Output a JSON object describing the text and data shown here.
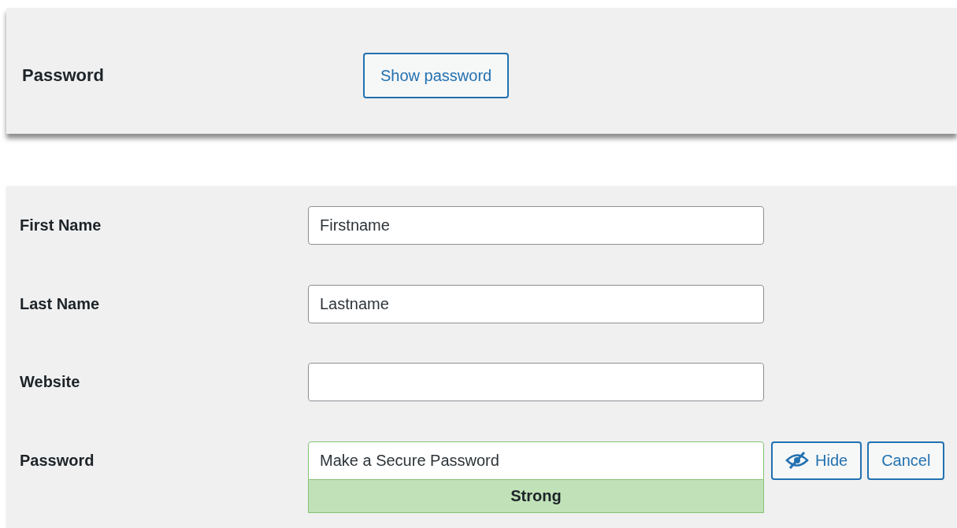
{
  "top_panel": {
    "label": "Password",
    "button": "Show password"
  },
  "form": {
    "rows": [
      {
        "kind": "text",
        "label": "First Name",
        "value": "Firstname"
      },
      {
        "kind": "text",
        "label": "Last Name",
        "value": "Lastname"
      },
      {
        "kind": "text",
        "label": "Website"
      },
      {
        "kind": "password",
        "label": "Password",
        "value": "Make a Secure Password",
        "strength": {
          "kind": "strong",
          "label": "Strong"
        },
        "buttons": [
          {
            "kind": "hide",
            "label": "Hide"
          },
          {
            "kind": "cancel",
            "label": "Cancel"
          }
        ]
      }
    ]
  }
}
